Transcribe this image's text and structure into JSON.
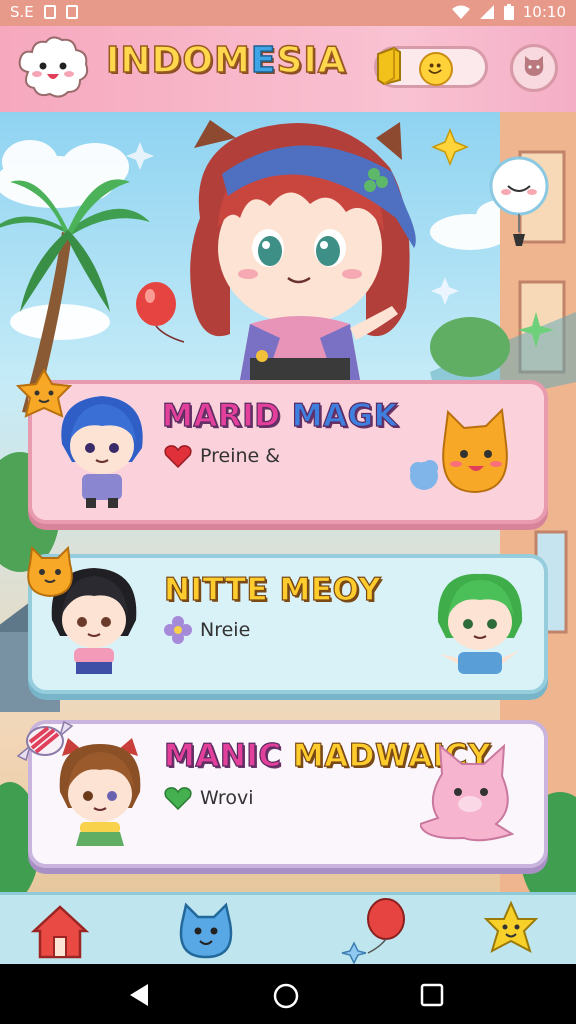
{
  "status_bar": {
    "left_text": "S.E",
    "time": "10:10"
  },
  "header": {
    "title_part1": "INDOM",
    "title_e": "E",
    "title_part2": "SIA"
  },
  "cards": [
    {
      "title_a": "MARID",
      "title_b": "MAGK",
      "sub": "Preine &",
      "sub_icon": "heart-icon"
    },
    {
      "title_a": "NITTE",
      "title_b": "MEOY",
      "sub": "Nreie",
      "sub_icon": "flower-icon"
    },
    {
      "title_a": "MANIC",
      "title_b": "MADWAICY",
      "sub": "Wrovi",
      "sub_icon": "green-heart-icon"
    }
  ],
  "nav": {
    "items": [
      "home-icon",
      "cat-blob-icon",
      "balloon-icon",
      "star-creature-icon"
    ]
  },
  "colors": {
    "header_pink": "#f6a8be",
    "title_yellow": "#ffd84d",
    "title_blue": "#3fa5e6",
    "card1": "#fbd2dc",
    "card2": "#d9f2f8",
    "card3": "#fbf6fb",
    "magenta": "#e2409a"
  }
}
